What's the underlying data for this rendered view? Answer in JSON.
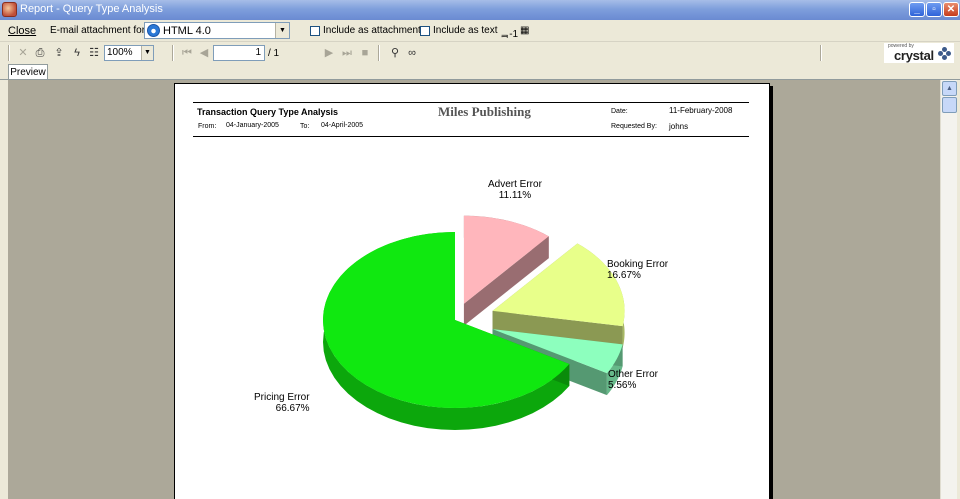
{
  "window": {
    "title": "Report - Query Type Analysis"
  },
  "toolbar": {
    "close_label": "Close",
    "email_format_label": "E-mail attachment format:",
    "email_format_value": "HTML 4.0",
    "include_attachment_label": "Include as attachment",
    "include_text_label": "Include as text",
    "zoom_value": "100%",
    "page_current": "1",
    "page_total": "/ 1",
    "brand_powered": "powered by",
    "brand_name": "crystal"
  },
  "tabs": [
    {
      "label": "Preview"
    }
  ],
  "report": {
    "title": "Transaction Query Type Analysis",
    "company": "Miles Publishing",
    "from_label": "From:",
    "from_date": "04-January-2005",
    "to_label": "To:",
    "to_date": "04-April-2005",
    "date_label": "Date:",
    "date_value": "11-February-2008",
    "requested_label": "Requested By:",
    "requested_value": "johns"
  },
  "chart_data": {
    "type": "pie",
    "slices": [
      {
        "label": "Advert Error",
        "percent_label": "11.11%",
        "value": 11.11,
        "color": "#ffb6bc"
      },
      {
        "label": "Booking Error",
        "percent_label": "16.67%",
        "value": 16.67,
        "color": "#e8ff8a"
      },
      {
        "label": "Other Error",
        "percent_label": "5.56%",
        "value": 5.56,
        "color": "#8dffbe"
      },
      {
        "label": "Pricing Error",
        "percent_label": "66.67%",
        "value": 66.67,
        "color": "#10e810"
      }
    ],
    "exploded": true,
    "three_d": true
  }
}
